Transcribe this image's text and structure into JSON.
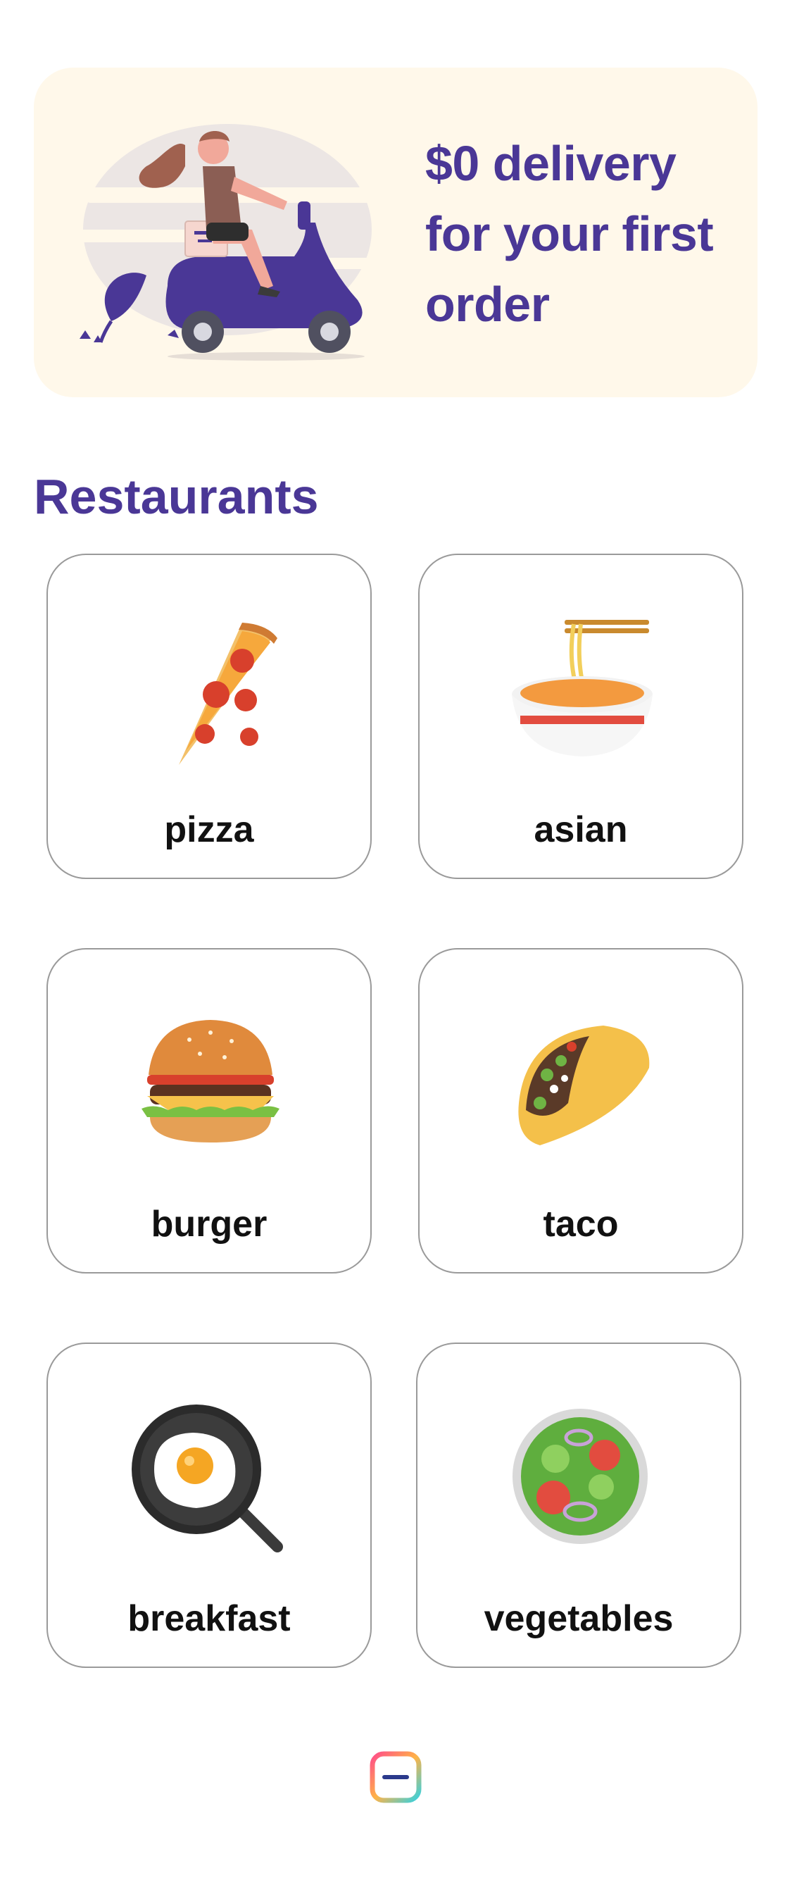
{
  "promo": {
    "headline": "$0 delivery for your first order",
    "illustration": "delivery-scooter-illustration"
  },
  "restaurants": {
    "title": "Restaurants",
    "categories": [
      {
        "label": "pizza",
        "icon": "pizza-icon"
      },
      {
        "label": "asian",
        "icon": "noodle-bowl-icon"
      },
      {
        "label": "burger",
        "icon": "burger-icon"
      },
      {
        "label": "taco",
        "icon": "taco-icon"
      },
      {
        "label": "breakfast",
        "icon": "fried-egg-pan-icon"
      },
      {
        "label": "vegetables",
        "icon": "salad-icon"
      }
    ]
  },
  "footer": {
    "logo": "app-logo-icon"
  },
  "colors": {
    "accent": "#4a3796",
    "promo_bg": "#fff8ea",
    "card_border": "#9a9a9a"
  }
}
